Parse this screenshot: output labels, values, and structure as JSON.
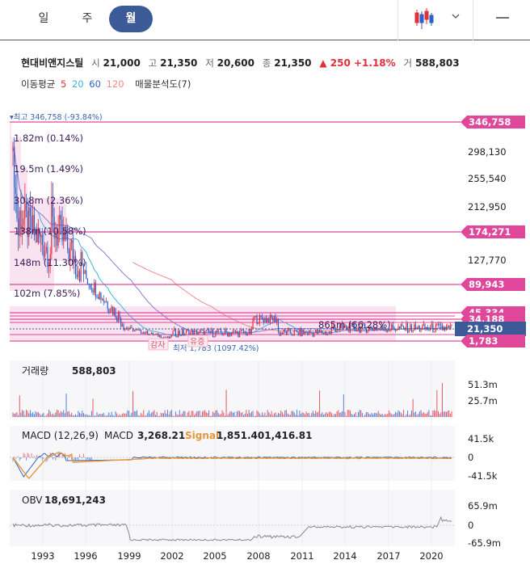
{
  "tabs": [
    {
      "label": "일"
    },
    {
      "label": "주"
    },
    {
      "label": "월"
    }
  ],
  "active_tab": 2,
  "menu_icon": "hamburger-icon",
  "chart_type_icon": "candlestick-icon",
  "stock": {
    "name": "현대비앤지스틸",
    "open_label": "시",
    "open": "21,000",
    "high_label": "고",
    "high": "21,350",
    "low_label": "저",
    "low": "20,600",
    "close_label": "종",
    "close": "21,350",
    "change": "▲ 250 +1.18%",
    "volume_label": "거",
    "volume": "588,803"
  },
  "indicators": {
    "ma_label": "이동평균",
    "ma5": "5",
    "ma20": "20",
    "ma60": "60",
    "ma120": "120",
    "profile": "매물분석도(7)"
  },
  "colors": {
    "up": "#e0303a",
    "down": "#2a62c9",
    "ma5": "#3bb5e0",
    "ma20": "#3bb5e0",
    "ma60": "#8f78d9",
    "ma120": "#f08a8a",
    "pink": "#e0479a",
    "price_tag": "#3d5a98",
    "signal": "#e8963a"
  },
  "chart_data": [
    {
      "type": "line",
      "panel": "price",
      "y_ticks": [
        "346,758",
        "298,130",
        "255,540",
        "212,950",
        "174,271",
        "127,770",
        "89,943",
        "45,334",
        "34,188",
        "21,350",
        "1,783"
      ],
      "pink_levels": [
        346758,
        174271,
        89943,
        45334,
        34188,
        1783
      ],
      "current": 21350,
      "max_label": "▾최고 346,758 (-93.84%)",
      "min_label": "최저 1,783 (1097.42%)",
      "events": [
        "감자",
        "유증"
      ],
      "volume_profile": [
        {
          "label": "1.82m (0.14%)"
        },
        {
          "label": "19.5m (1.49%)"
        },
        {
          "label": "30.8m (2.36%)"
        },
        {
          "label": "138m (10.58%)"
        },
        {
          "label": "148m (11.30%)"
        },
        {
          "label": "102m (7.85%)"
        },
        {
          "label": "865m (66.28%)"
        }
      ]
    },
    {
      "type": "bar",
      "panel": "volume",
      "label": "거래량",
      "value": "588,803",
      "y_ticks": [
        "51.3m",
        "25.7m"
      ]
    },
    {
      "type": "line",
      "panel": "macd",
      "label": "MACD (12,26,9)",
      "macd_label": "MACD",
      "macd": "3,268.21",
      "signal_label": "Signal",
      "signal": "1,851.401,416.81",
      "y_ticks": [
        "41.5k",
        "0",
        "-41.5k"
      ]
    },
    {
      "type": "line",
      "panel": "obv",
      "label": "OBV",
      "value": "18,691,243",
      "y_ticks": [
        "65.9m",
        "0",
        "-65.9m"
      ]
    }
  ],
  "x_axis": [
    "1993",
    "1996",
    "1999",
    "2002",
    "2005",
    "2008",
    "2011",
    "2014",
    "2017",
    "2020"
  ]
}
